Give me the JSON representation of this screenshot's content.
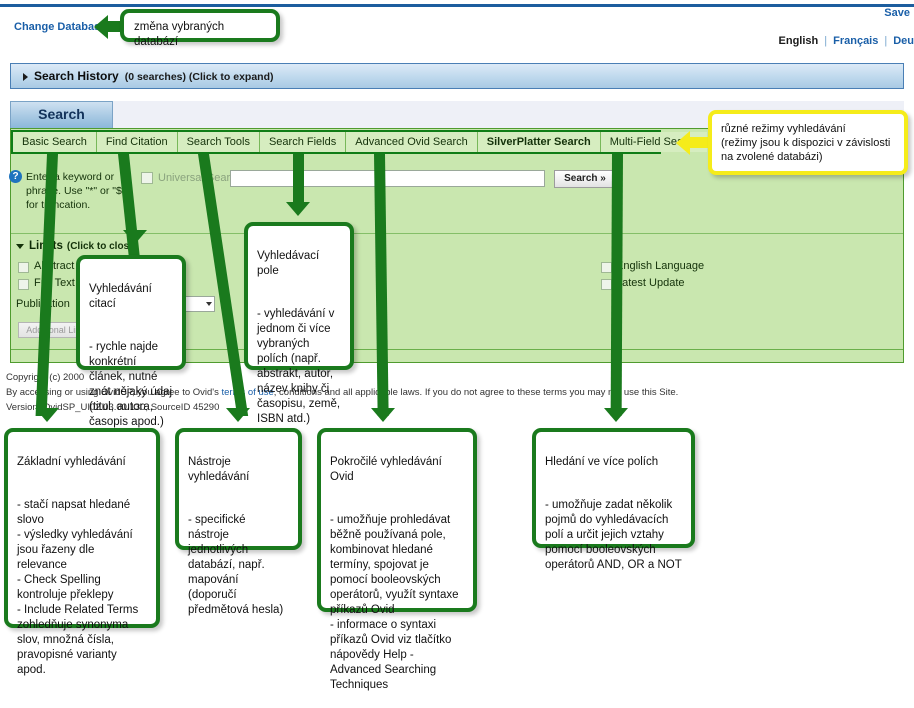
{
  "header": {
    "save_link": "Save",
    "change_database": "Change Database",
    "languages": [
      {
        "label": "English",
        "current": true
      },
      {
        "label": "Français",
        "current": false
      },
      {
        "label": "Deu",
        "current": false
      }
    ],
    "lang_separator": "|"
  },
  "search_history": {
    "title": "Search History",
    "subtitle": "(0 searches) (Click to expand)"
  },
  "page_tab": {
    "label": "Search"
  },
  "mode_tabs": [
    {
      "label": "Basic Search",
      "active": false
    },
    {
      "label": "Find Citation",
      "active": false
    },
    {
      "label": "Search Tools",
      "active": false
    },
    {
      "label": "Search Fields",
      "active": false
    },
    {
      "label": "Advanced Ovid Search",
      "active": false
    },
    {
      "label": "SilverPlatter Search",
      "active": true
    },
    {
      "label": "Multi-Field Search",
      "active": false
    }
  ],
  "search_form": {
    "help_icon": "question-mark-icon",
    "keyword_help": "Enter a keyword or phrase. Use \"*\" or \"$\" for truncation.",
    "universal_search_label": "Universal Search",
    "universal_search_checked": false,
    "query_value": "",
    "query_placeholder": "",
    "search_button": "Search »"
  },
  "limits": {
    "title": "Limits",
    "subtitle": "(Click to close)",
    "checkboxes_left": [
      {
        "label": "Abstract",
        "checked": false
      },
      {
        "label": "Full Text",
        "checked": false
      }
    ],
    "checkboxes_right": [
      {
        "label": "English Language",
        "checked": false
      },
      {
        "label": "Latest Update",
        "checked": false
      }
    ],
    "publication_year_label": "Publication",
    "publication_year_value": "",
    "additional_limits_button": "Additional Limits"
  },
  "footer": {
    "copyright": "Copyright (c) 2000",
    "terms_prefix": "By accessing or using OvidSP, you agree to Ovid's ",
    "terms_link": "terms of use",
    "terms_suffix": ", conditions and all applicable laws. If you do not agree to these terms you may not use this Site.",
    "version": "Version: OvidSP_UI02.03.00.130, SourceID 45290"
  },
  "callouts": {
    "change_db": {
      "text": "změna vybraných databází"
    },
    "modes": {
      "text": "různé režimy vyhledávání\n(režimy jsou k dispozici v závislosti\nna zvolené databázi)"
    },
    "find_citation": {
      "title": "Vyhledávání citací",
      "body": "- rychle najde konkrétní článek, nutné znát nějaký údaj (titul, autora, časopis apod.)"
    },
    "search_fields": {
      "title": "Vyhledávací pole",
      "body": "- vyhledávání v jednom či více vybraných polích (např. abstrakt, autor, název knihy či časopisu, země, ISBN atd.)"
    },
    "basic_search": {
      "title": "Základní vyhledávání",
      "body": "- stačí napsat hledané slovo\n- výsledky vyhledávání jsou řazeny dle relevance\n- Check Spelling kontroluje překlepy\n- Include Related Terms zohledňuje synonyma slov, množná čísla, pravopisné varianty apod."
    },
    "search_tools": {
      "title": "Nástroje vyhledávání",
      "body": "- specifické nástroje jednotlivých databází, např. mapování (doporučí předmětová hesla)"
    },
    "advanced_ovid": {
      "title": "Pokročilé vyhledávání Ovid",
      "body": "- umožňuje prohledávat běžně používaná pole, kombinovat hledané termíny, spojovat je pomocí booleovských operátorů, využít syntaxe příkazů Ovid\n- informace o syntaxi příkazů Ovid viz tlačítko nápovědy Help - Advanced Searching Techniques"
    },
    "multi_field": {
      "title": "Hledání ve více polích",
      "body": "- umožňuje zadat několik pojmů do vyhledávacích polí a určit jejich vztahy pomocí booleovských operátorů AND, OR a NOT"
    }
  },
  "colors": {
    "green_panel": "#C9E7AF",
    "green_accent": "#1A7A1D",
    "yellow_accent": "#F5EC1A",
    "blue_link": "#1A5FA8"
  }
}
